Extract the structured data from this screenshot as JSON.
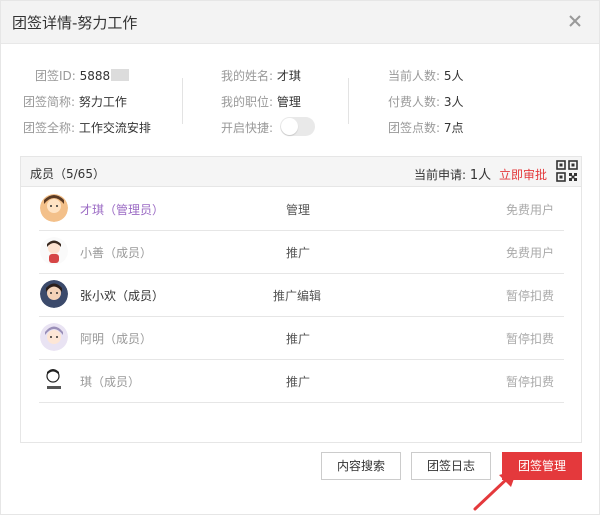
{
  "dialog": {
    "title": "团签详情-努力工作"
  },
  "info": {
    "group_id_label": "团签ID:",
    "group_id_value": "5888",
    "short_name_label": "团签简称:",
    "short_name_value": "努力工作",
    "full_name_label": "团签全称:",
    "full_name_value": "工作交流安排",
    "my_name_label": "我的姓名:",
    "my_name_value": "才琪",
    "my_role_label": "我的职位:",
    "my_role_value": "管理",
    "shortcut_label": "开启快捷:",
    "shortcut_enabled": false,
    "current_count_label": "当前人数:",
    "current_count_value": "5人",
    "paid_count_label": "付费人数:",
    "paid_count_value": "3人",
    "points_label": "团签点数:",
    "points_value": "7点"
  },
  "members_panel": {
    "header_label": "成员（5/65）",
    "pending_label": "当前申请:",
    "pending_count": "1人",
    "approve_label": "立即审批",
    "members": [
      {
        "name": "才琪（管理员）",
        "role": "管理",
        "status": "免费用户",
        "name_color": "#9b6bc4"
      },
      {
        "name": "小善（成员）",
        "role": "推广",
        "status": "免费用户",
        "name_color": "#999999"
      },
      {
        "name": "张小欢（成员）",
        "role": "推广编辑",
        "status": "暂停扣费",
        "name_color": "#333333"
      },
      {
        "name": "阿明（成员）",
        "role": "推广",
        "status": "暂停扣费",
        "name_color": "#999999"
      },
      {
        "name": "琪（成员）",
        "role": "推广",
        "status": "暂停扣费",
        "name_color": "#999999"
      }
    ]
  },
  "footer": {
    "content_search_label": "内容搜索",
    "log_label": "团签日志",
    "manage_label": "团签管理"
  },
  "colors": {
    "accent": "#e4393c",
    "admin_name": "#9b6bc4"
  }
}
